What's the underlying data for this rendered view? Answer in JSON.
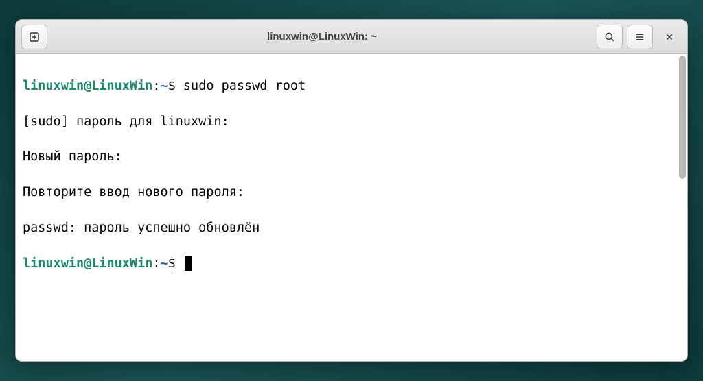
{
  "window": {
    "title": "linuxwin@LinuxWin: ~"
  },
  "prompt": {
    "userhost": "linuxwin@LinuxWin",
    "sep": ":",
    "path": "~",
    "symbol": "$ "
  },
  "lines": {
    "cmd1": "sudo passwd root",
    "out1": "[sudo] пароль для linuxwin:",
    "out2": "Новый пароль:",
    "out3": "Повторите ввод нового пароля:",
    "out4": "passwd: пароль успешно обновлён"
  },
  "icons": {
    "new_tab": "new-tab",
    "search": "search",
    "menu": "menu",
    "close": "close"
  }
}
